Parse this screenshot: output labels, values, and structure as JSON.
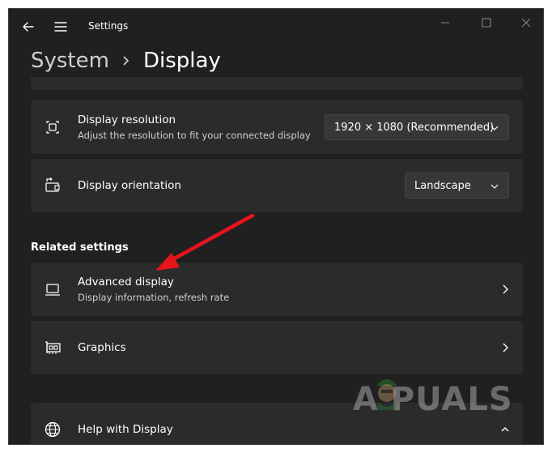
{
  "window": {
    "title": "Settings"
  },
  "breadcrumb": {
    "parent": "System",
    "current": "Display"
  },
  "settings": {
    "resolution": {
      "title": "Display resolution",
      "subtitle": "Adjust the resolution to fit your connected display",
      "value": "1920 × 1080 (Recommended)",
      "icon": "resolution-icon"
    },
    "orientation": {
      "title": "Display orientation",
      "value": "Landscape",
      "icon": "orientation-icon"
    }
  },
  "related": {
    "heading": "Related settings",
    "advanced": {
      "title": "Advanced display",
      "subtitle": "Display information, refresh rate",
      "icon": "monitor-icon"
    },
    "graphics": {
      "title": "Graphics",
      "icon": "graphics-card-icon"
    }
  },
  "help": {
    "title": "Help with Display",
    "icon": "globe-icon"
  },
  "watermark": {
    "brand": "A PUALS"
  },
  "colors": {
    "background": "#202020",
    "card": "#2b2b2b",
    "annotation_arrow": "#e8141c"
  }
}
